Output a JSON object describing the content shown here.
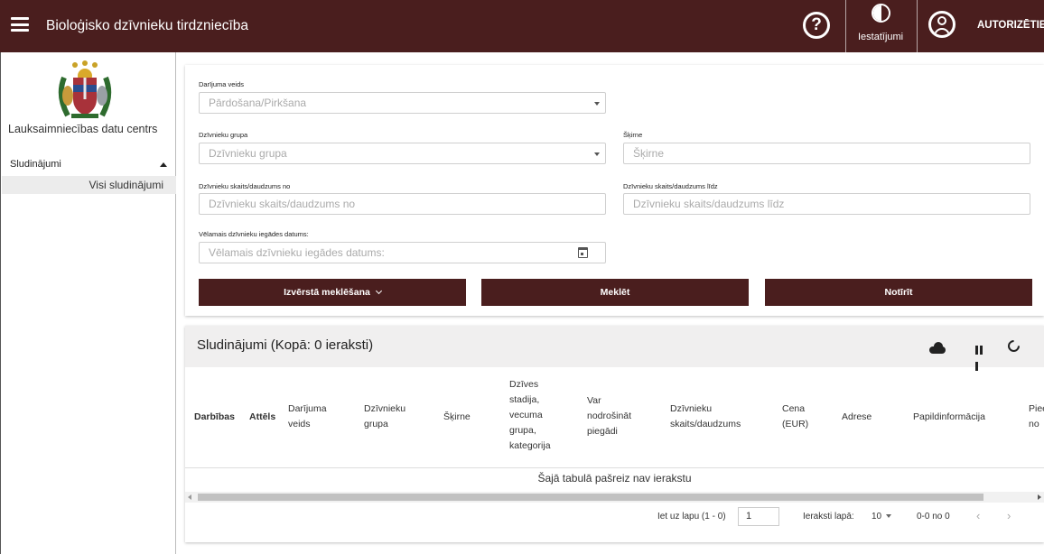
{
  "header": {
    "title": "Bioloģisko dzīvnieku tirdzniecība",
    "help_icon": "?",
    "settings_label": "Iestatījumi",
    "login_label": "AUTORIZĒTIES"
  },
  "sidebar": {
    "org_name": "Lauksaimniecības datu centrs",
    "group_label": "Sludinājumi",
    "items": [
      {
        "label": "Visi sludinājumi"
      }
    ]
  },
  "filters": {
    "deal_type": {
      "label": "Darījuma veids",
      "value": "Pārdošana/Pirkšana"
    },
    "animal_group": {
      "label": "Dzīvnieku grupa",
      "placeholder": "Dzīvnieku grupa"
    },
    "breed": {
      "label": "Šķirne",
      "placeholder": "Šķirne"
    },
    "count_from": {
      "label": "Dzīvnieku skaits/daudzums no",
      "placeholder": "Dzīvnieku skaits/daudzums no"
    },
    "count_to": {
      "label": "Dzīvnieku skaits/daudzums līdz",
      "placeholder": "Dzīvnieku skaits/daudzums līdz"
    },
    "date": {
      "label": "Vēlamais dzīvnieku iegādes datums:",
      "placeholder": "Vēlamais dzīvnieku iegādes datums:"
    },
    "buttons": {
      "advanced": "Izvērstā meklēšana",
      "search": "Meklēt",
      "clear": "Notīrīt"
    }
  },
  "results": {
    "title": "Sludinājumi (Kopā: 0 ieraksti)",
    "columns": {
      "actions": "Darbības",
      "image": "Attēls",
      "deal_type": [
        "Darījuma",
        "veids"
      ],
      "animal_group": [
        "Dzīvnieku",
        "grupa"
      ],
      "breed": "Šķirne",
      "stage": [
        "Dzīves",
        "stadija,",
        "vecuma",
        "grupa,",
        "kategorija"
      ],
      "delivery": [
        "Var",
        "nodrošināt",
        "piegādi"
      ],
      "count": [
        "Dzīvnieku",
        "skaits/daudzums"
      ],
      "price": [
        "Cena",
        "(EUR)"
      ],
      "address": "Adrese",
      "additional": "Papildinformācija",
      "available": [
        "Pieej",
        "no"
      ]
    },
    "empty_message": "Šajā tabulā pašreiz nav ierakstu",
    "pager": {
      "goto_label": "Iet uz lapu (1 - 0)",
      "goto_value": "1",
      "per_page_label": "Ieraksti lapā:",
      "per_page_value": "10",
      "range": "0-0 no 0",
      "prev": "‹",
      "next": "›"
    }
  },
  "colors": {
    "brand": "#4a1e1e",
    "panel_header": "#f0efef"
  }
}
